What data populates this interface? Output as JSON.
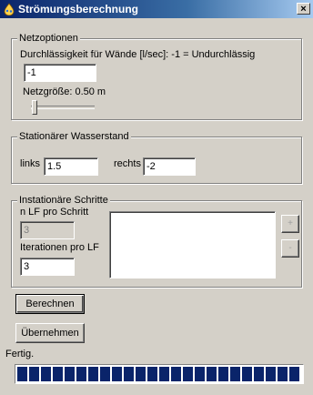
{
  "window": {
    "title": "Strömungsberechnung",
    "close_label": "×",
    "icon": "water-app-icon"
  },
  "netzoptionen": {
    "legend": "Netzoptionen",
    "permeability_label": "Durchlässigkeit für Wände [l/sec]: -1 = Undurchlässig",
    "permeability_value": "-1",
    "grid_size_label": "Netzgröße: 0.50 m",
    "grid_size_slider": 0.0
  },
  "wasserstand": {
    "legend": "Stationärer Wasserstand",
    "left_label": "links",
    "left_value": "1.5",
    "right_label": "rechts",
    "right_value": "-2"
  },
  "schritte": {
    "legend": "Instationäre Schritte",
    "lf_label": "n LF pro Schritt",
    "lf_value": "3",
    "iter_label": "Iterationen pro LF",
    "iter_value": "3",
    "add_label": "+",
    "remove_label": "-"
  },
  "actions": {
    "calculate_label": "Berechnen",
    "apply_label": "Übernehmen"
  },
  "status": {
    "text": "Fertig.",
    "progress": 1.0
  }
}
